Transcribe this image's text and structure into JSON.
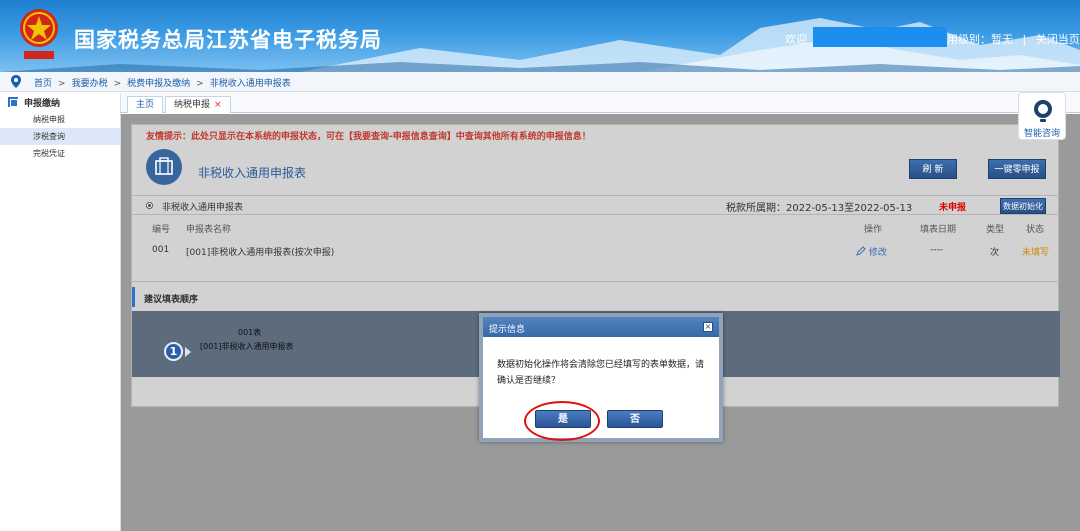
{
  "header": {
    "site_title": "国家税务总局江苏省电子税务局",
    "welcome": "欢迎",
    "credit_level": "用级别：暂无",
    "separator": "|",
    "close_page": "关闭当页",
    "colors": {
      "header_blue": "#2a8ad9",
      "redact": "#1d8ef0"
    }
  },
  "breadcrumb": {
    "items": [
      "首页",
      "我要办税",
      "税费申报及缴纳",
      "非税收入通用申报表"
    ],
    "sep": ">"
  },
  "sidebar": {
    "section": "申报缴纳",
    "items": [
      "纳税申报",
      "涉税查询",
      "完税凭证"
    ],
    "active_index": 1
  },
  "tabs": [
    {
      "label": "主页"
    },
    {
      "label": "纳税申报",
      "close": "×"
    }
  ],
  "main": {
    "tip": "友情提示：此处只显示在本系统的申报状态，可在【我要查询-申报信息查询】中查询其他所有系统的申报信息！",
    "form_title": "非税收入通用申报表",
    "refresh_label": "刷 新",
    "zero_declare_label": "一键零申报",
    "category": "非税收入通用申报表",
    "period": "税款所属期：2022-05-13至2022-05-13",
    "declare_status": "未申报",
    "init_label": "数据初始化",
    "columns": {
      "no": "编号",
      "name": "申报表名称",
      "op": "操作",
      "date": "填表日期",
      "type": "类型",
      "status": "状态"
    },
    "rows": [
      {
        "no": "001",
        "name": "[001]非税收入通用申报表(按次申报)",
        "op": "修改",
        "date": "----",
        "type": "次",
        "status": "未填写"
      }
    ],
    "order_title": "建议填表顺序",
    "step": {
      "number": "1",
      "line1": "001表",
      "line2": "[001]非税收入通用申报表"
    }
  },
  "help": {
    "label": "智能咨询"
  },
  "dialog": {
    "title": "提示信息",
    "close": "×",
    "message": "数据初始化操作将会清除您已经填写的表单数据，请确认是否继续？",
    "yes": "是",
    "no": "否",
    "highlight_color": "#e01010"
  }
}
